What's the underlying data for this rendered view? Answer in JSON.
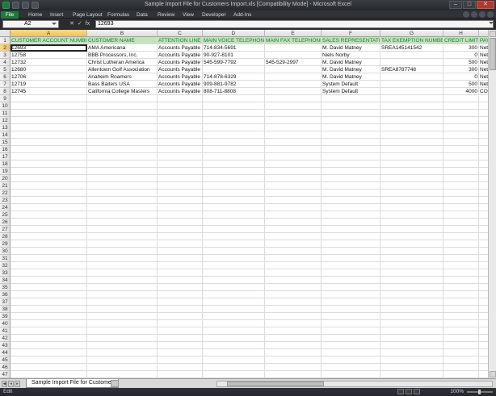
{
  "window": {
    "title": "Sample Import File for Customers Import.xls [Compatibility Mode] - Microsoft Excel",
    "buttons": {
      "minimize": "–",
      "maximize": "□",
      "close": "✕"
    }
  },
  "ribbon": {
    "tabs": [
      "File",
      "Home",
      "Insert",
      "Page Layout",
      "Formulas",
      "Data",
      "Review",
      "View",
      "Developer",
      "Add-Ins"
    ]
  },
  "formula_bar": {
    "name_box": "A2",
    "cancel": "✕",
    "enter": "✓",
    "fx": "fx",
    "formula": "12693"
  },
  "sheet": {
    "columns": [
      "A",
      "B",
      "C",
      "D",
      "E",
      "F",
      "G",
      "H",
      ""
    ],
    "header_row": [
      "CUSTOMER ACCOUNT NUMBER",
      "CUSTOMER NAME",
      "ATTENTION LINE",
      "MAIN VOICE TELEPHONE",
      "MAIN FAX TELEPHONE",
      "SALES REPRESENTATIVE",
      "TAX EXEMPTION NUMBER",
      "CREDIT LIMIT",
      "PAYMENT TERMS"
    ],
    "rows": [
      [
        "12693",
        "AMA Americana",
        "Accounts Payable",
        "714-834-5691",
        "",
        "M. David Matney",
        "SREA145141542",
        "300",
        "Net Due"
      ],
      [
        "12758",
        "BBB Processors, Inc.",
        "Accounts Payable",
        "90-927-8101",
        "",
        "Niels Norby",
        "",
        "0",
        "Net Due"
      ],
      [
        "12732",
        "Christ Lutheran America",
        "Accounts Payable",
        "545-599-7792",
        "545-529-2997",
        "M. David Matney",
        "",
        "500",
        "Net Due"
      ],
      [
        "12680",
        "Allentown Golf Association",
        "Accounts Payable",
        "",
        "",
        "M. David Matney",
        "SREA8787748",
        "300",
        "Net Due"
      ],
      [
        "12706",
        "Anaheim Roamers",
        "Accounts Payable",
        "714-878-6329",
        "",
        "M. David Matney",
        "",
        "0",
        "Net Due"
      ],
      [
        "12719",
        "Bass Baiters USA",
        "Accounts Payable",
        "909-881-9782",
        "",
        "System Default",
        "",
        "500",
        "Net Due"
      ],
      [
        "12745",
        "California College Masters",
        "Accounts Payable",
        "808-711-8808",
        "",
        "System Default",
        "",
        "4000",
        "COD"
      ]
    ],
    "row_numbers": [
      "1",
      "2",
      "3",
      "4",
      "5",
      "6",
      "7",
      "8",
      "9",
      "10",
      "11",
      "12",
      "13",
      "14",
      "15",
      "16",
      "17",
      "18",
      "19",
      "20",
      "21",
      "22",
      "23",
      "24",
      "25",
      "26",
      "27",
      "28",
      "29",
      "30",
      "31",
      "32",
      "33",
      "34",
      "35",
      "36",
      "37",
      "38",
      "39",
      "40",
      "41",
      "42",
      "43",
      "44",
      "45",
      "46",
      "47"
    ],
    "active_cell": "A2"
  },
  "tabs": {
    "sheet_name": "Sample Import File for Customer"
  },
  "status": {
    "mode": "Edit",
    "zoom": "100%"
  },
  "colors": {
    "header_fill": "#c4e3bd",
    "header_text": "#1f7a3a",
    "file_tab": "#1f7a3a",
    "selection": "#f1c15a"
  }
}
